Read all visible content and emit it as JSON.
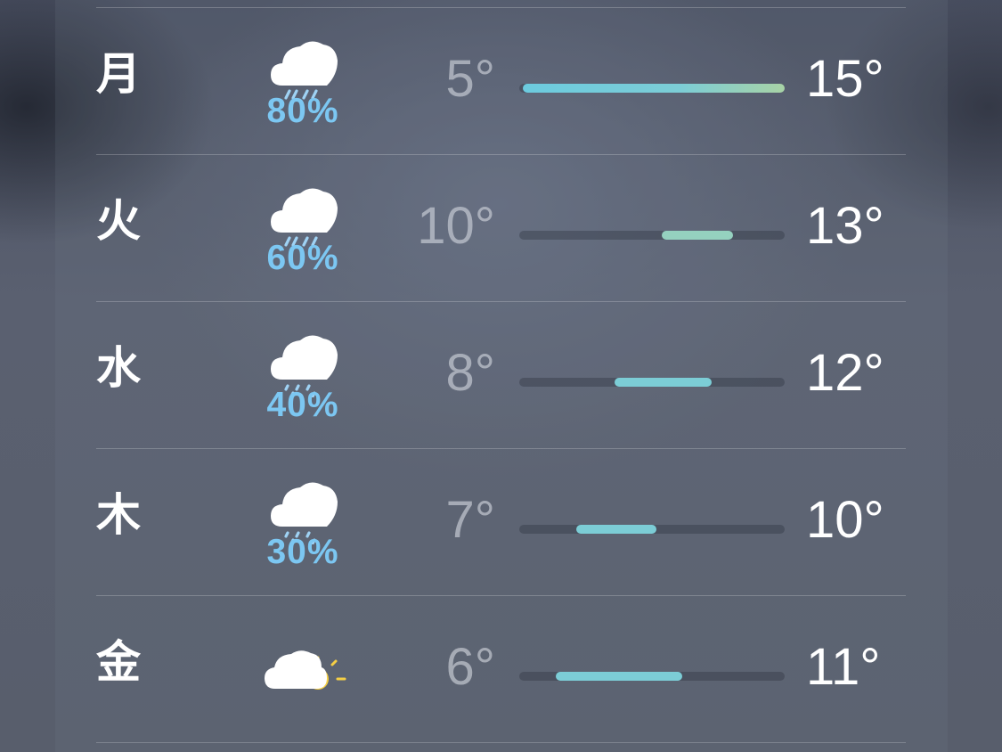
{
  "colors": {
    "precip_text": "#7cc7f2",
    "bar_gradient_start": "#6ccbdf",
    "bar_gradient_end": "#a8d3a6",
    "bar_teal": "#7ccdd6",
    "bar_mint": "#95d1bf"
  },
  "scale": {
    "min_temp": 5,
    "max_temp": 15
  },
  "forecast": [
    {
      "day": "月",
      "icon": "cloud-heavy-rain-icon",
      "precip": "80%",
      "low": "5°",
      "high": "15°",
      "low_value": 5,
      "high_value": 15
    },
    {
      "day": "火",
      "icon": "cloud-heavy-rain-icon",
      "precip": "60%",
      "low": "10°",
      "high": "13°",
      "low_value": 10,
      "high_value": 13
    },
    {
      "day": "水",
      "icon": "cloud-rain-icon",
      "precip": "40%",
      "low": "8°",
      "high": "12°",
      "low_value": 8,
      "high_value": 12
    },
    {
      "day": "木",
      "icon": "cloud-rain-icon",
      "precip": "30%",
      "low": "7°",
      "high": "10°",
      "low_value": 7,
      "high_value": 10
    },
    {
      "day": "金",
      "icon": "partly-sunny-icon",
      "precip": "",
      "low": "6°",
      "high": "11°",
      "low_value": 6,
      "high_value": 11
    }
  ]
}
